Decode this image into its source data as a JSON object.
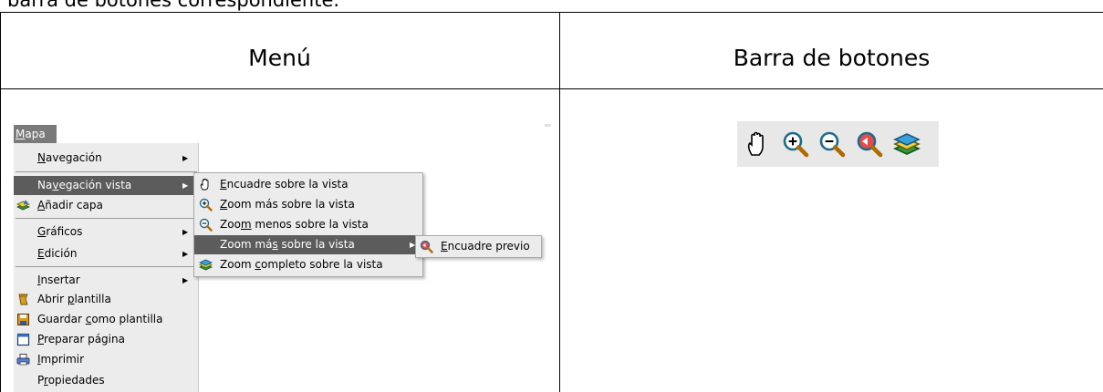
{
  "intro_text": "barra de botones correspondiente.",
  "table": {
    "col1_header": "Menú",
    "col2_header": "Barra de botones"
  },
  "menu_bar": {
    "title": "Mapa",
    "mnemonic": "M",
    "rest": "apa"
  },
  "main_menu": {
    "items": [
      {
        "pre": "",
        "mn": "N",
        "post": "avegación",
        "icon": "",
        "submenu": true
      },
      {
        "pre": "Na",
        "mn": "v",
        "post": "egación vista",
        "icon": "",
        "submenu": true,
        "highlighted": true
      },
      {
        "pre": "",
        "mn": "A",
        "post": "ñadir capa",
        "icon": "add-layer-icon",
        "submenu": false
      },
      {
        "pre": "",
        "mn": "G",
        "post": "ráficos",
        "icon": "",
        "submenu": true
      },
      {
        "pre": "",
        "mn": "E",
        "post": "dición",
        "icon": "",
        "submenu": true
      },
      {
        "pre": "",
        "mn": "I",
        "post": "nsertar",
        "icon": "",
        "submenu": true
      },
      {
        "pre": "Abrir ",
        "mn": "p",
        "post": "lantilla",
        "icon": "open-template-icon",
        "submenu": false
      },
      {
        "pre": "Guardar ",
        "mn": "c",
        "post": "omo plantilla",
        "icon": "save-template-icon",
        "submenu": false
      },
      {
        "pre": "",
        "mn": "P",
        "post": "reparar página",
        "icon": "page-setup-icon",
        "submenu": false
      },
      {
        "pre": "",
        "mn": "I",
        "post": "mprimir",
        "icon": "print-icon",
        "submenu": false
      },
      {
        "pre": "P",
        "mn": "r",
        "post": "opiedades",
        "icon": "",
        "submenu": false
      }
    ]
  },
  "view_submenu": {
    "items": [
      {
        "pre": "",
        "mn": "E",
        "post": "ncuadre sobre la vista",
        "icon": "pan-hand-icon",
        "submenu": false
      },
      {
        "pre": "",
        "mn": "Z",
        "post": "oom más sobre la vista",
        "icon": "zoom-in-icon",
        "submenu": false
      },
      {
        "pre": "Zoo",
        "mn": "m",
        "post": " menos sobre la vista",
        "icon": "zoom-out-icon",
        "submenu": false
      },
      {
        "pre": "Zoom má",
        "mn": "s",
        "post": " sobre la vista",
        "icon": "",
        "submenu": true,
        "highlighted": true
      },
      {
        "pre": "Zoom ",
        "mn": "c",
        "post": "ompleto sobre la vista",
        "icon": "zoom-full-icon",
        "submenu": false
      }
    ]
  },
  "zoom_submenu": {
    "items": [
      {
        "pre": "",
        "mn": "E",
        "post": "ncuadre previo",
        "icon": "zoom-previous-icon",
        "submenu": false
      }
    ]
  },
  "toolbar": {
    "buttons": [
      "pan-hand-icon",
      "zoom-in-icon",
      "zoom-out-icon",
      "zoom-previous-icon",
      "zoom-full-icon"
    ]
  }
}
